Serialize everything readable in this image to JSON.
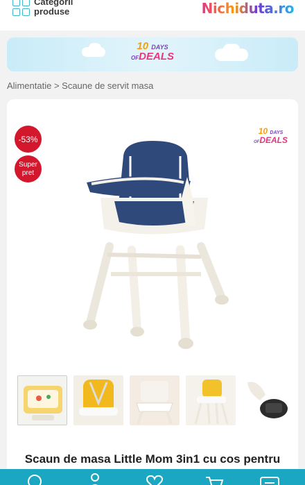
{
  "header": {
    "categories_label_1": "Categorii",
    "categories_label_2": "produse",
    "logo_text": "Nichiduta.ro"
  },
  "banner": {
    "line1_num": "10",
    "line1_word": "DAYS",
    "line2_prefix": "OF",
    "line2_word": "DEALS"
  },
  "breadcrumb": {
    "parent": "Alimentatie",
    "separator": ">",
    "current": "Scaune de servit masa"
  },
  "product": {
    "discount_badge": "-53%",
    "super_badge_1": "Super",
    "super_badge_2": "pret",
    "promo_num": "10",
    "promo_word": "DAYS",
    "promo_prefix": "OF",
    "promo_word2": "DEALS",
    "title": "Scaun de masa Little Mom 3in1 cu cos pentru",
    "main_color": "#2f4a7a",
    "thumbnails": [
      "thumb-1",
      "thumb-2",
      "thumb-3",
      "thumb-4",
      "thumb-5"
    ]
  },
  "bottom_nav": {
    "items": [
      "search-icon",
      "user-icon",
      "heart-icon",
      "cart-icon",
      "menu-icon"
    ],
    "color": "#1ba7c1"
  }
}
